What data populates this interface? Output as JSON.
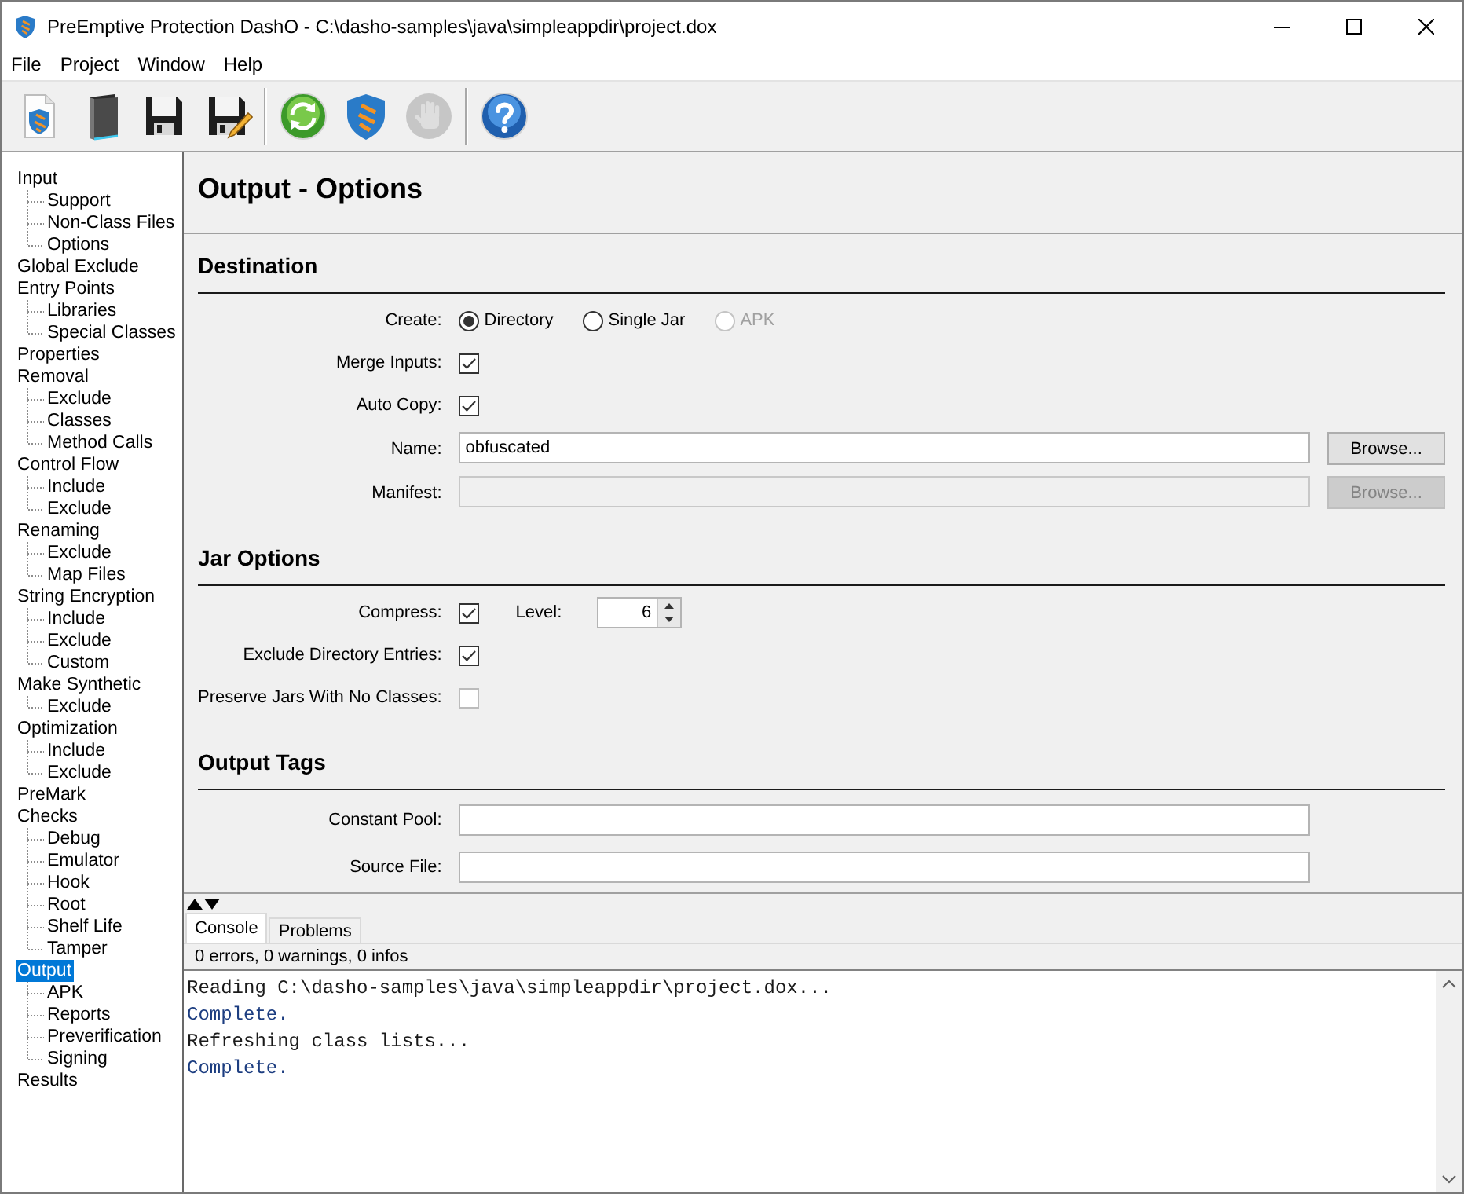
{
  "window": {
    "title": "PreEmptive Protection DashO - C:\\dasho-samples\\java\\simpleappdir\\project.dox"
  },
  "menu": [
    "File",
    "Project",
    "Window",
    "Help"
  ],
  "toolbar": [
    {
      "buttons": [
        {
          "kind": "new",
          "disabled": false
        },
        {
          "kind": "open",
          "disabled": false
        },
        {
          "kind": "save",
          "disabled": false
        },
        {
          "kind": "save-as",
          "disabled": false
        }
      ]
    },
    {
      "buttons": [
        {
          "kind": "refresh",
          "disabled": false
        },
        {
          "kind": "build",
          "disabled": false
        },
        {
          "kind": "stop",
          "disabled": true
        }
      ]
    },
    {
      "buttons": [
        {
          "kind": "help",
          "disabled": false
        }
      ]
    }
  ],
  "sidebar": {
    "items": [
      {
        "label": "Input",
        "selected": false,
        "children": [
          {
            "label": "Support",
            "selected": false
          },
          {
            "label": "Non-Class Files",
            "selected": false
          },
          {
            "label": "Options",
            "selected": false
          }
        ]
      },
      {
        "label": "Global Exclude",
        "selected": false
      },
      {
        "label": "Entry Points",
        "selected": false,
        "children": [
          {
            "label": "Libraries",
            "selected": false
          },
          {
            "label": "Special Classes",
            "selected": false
          }
        ]
      },
      {
        "label": "Properties",
        "selected": false
      },
      {
        "label": "Removal",
        "selected": false,
        "children": [
          {
            "label": "Exclude",
            "selected": false
          },
          {
            "label": "Classes",
            "selected": false
          },
          {
            "label": "Method Calls",
            "selected": false
          }
        ]
      },
      {
        "label": "Control Flow",
        "selected": false,
        "children": [
          {
            "label": "Include",
            "selected": false
          },
          {
            "label": "Exclude",
            "selected": false
          }
        ]
      },
      {
        "label": "Renaming",
        "selected": false,
        "children": [
          {
            "label": "Exclude",
            "selected": false
          },
          {
            "label": "Map Files",
            "selected": false
          }
        ]
      },
      {
        "label": "String Encryption",
        "selected": false,
        "children": [
          {
            "label": "Include",
            "selected": false
          },
          {
            "label": "Exclude",
            "selected": false
          },
          {
            "label": "Custom",
            "selected": false
          }
        ]
      },
      {
        "label": "Make Synthetic",
        "selected": false,
        "children": [
          {
            "label": "Exclude",
            "selected": false
          }
        ]
      },
      {
        "label": "Optimization",
        "selected": false,
        "children": [
          {
            "label": "Include",
            "selected": false
          },
          {
            "label": "Exclude",
            "selected": false
          }
        ]
      },
      {
        "label": "PreMark",
        "selected": false
      },
      {
        "label": "Checks",
        "selected": false,
        "children": [
          {
            "label": "Debug",
            "selected": false
          },
          {
            "label": "Emulator",
            "selected": false
          },
          {
            "label": "Hook",
            "selected": false
          },
          {
            "label": "Root",
            "selected": false
          },
          {
            "label": "Shelf Life",
            "selected": false
          },
          {
            "label": "Tamper",
            "selected": false
          }
        ]
      },
      {
        "label": "Output",
        "selected": true,
        "children": [
          {
            "label": "APK",
            "selected": false
          },
          {
            "label": "Reports",
            "selected": false
          },
          {
            "label": "Preverification",
            "selected": false
          },
          {
            "label": "Signing",
            "selected": false
          }
        ]
      },
      {
        "label": "Results",
        "selected": false
      }
    ]
  },
  "page": {
    "title": "Output - Options",
    "sections": [
      {
        "title": "Destination",
        "rows": [
          {
            "kind": "radio",
            "label": "Create:",
            "options": [
              {
                "label": "Directory",
                "selected": true,
                "disabled": false
              },
              {
                "label": "Single Jar",
                "selected": false,
                "disabled": false
              },
              {
                "label": "APK",
                "selected": false,
                "disabled": true
              }
            ]
          },
          {
            "kind": "checkbox",
            "label": "Merge Inputs:",
            "checked": true,
            "disabled": false
          },
          {
            "kind": "checkbox",
            "label": "Auto Copy:",
            "checked": true,
            "disabled": false
          },
          {
            "kind": "file",
            "label": "Name:",
            "value": "obfuscated",
            "disabled": false,
            "button": "Browse..."
          },
          {
            "kind": "file",
            "label": "Manifest:",
            "disabled": true,
            "button": "Browse..."
          }
        ]
      },
      {
        "title": "Jar Options",
        "rows": [
          {
            "kind": "checkbox",
            "label": "Compress:",
            "checked": true,
            "disabled": false,
            "spinner": {
              "label": "Level:",
              "value": "6"
            }
          },
          {
            "kind": "checkbox",
            "label": "Exclude Directory Entries:",
            "checked": true,
            "disabled": false
          },
          {
            "kind": "checkbox",
            "label": "Preserve Jars With No Classes:",
            "checked": false,
            "disabled": true
          }
        ]
      },
      {
        "title": "Output Tags",
        "rows": [
          {
            "kind": "text",
            "label": "Constant Pool:",
            "disabled": false
          },
          {
            "kind": "text",
            "label": "Source File:",
            "disabled": false
          }
        ]
      }
    ]
  },
  "bottom_panel": {
    "tabs": [
      {
        "label": "Console",
        "selected": true
      },
      {
        "label": "Problems",
        "selected": false
      }
    ],
    "status": "0 errors, 0 warnings, 0 infos",
    "lines": [
      {
        "text": "Reading C:\\dasho-samples\\java\\simpleappdir\\project.dox...",
        "color": "#1a1a1a"
      },
      {
        "text": "Complete.",
        "color": "#1c3d80"
      },
      {
        "text": "Refreshing class lists...",
        "color": "#1a1a1a"
      },
      {
        "text": "Complete.",
        "color": "#1c3d80"
      }
    ]
  }
}
